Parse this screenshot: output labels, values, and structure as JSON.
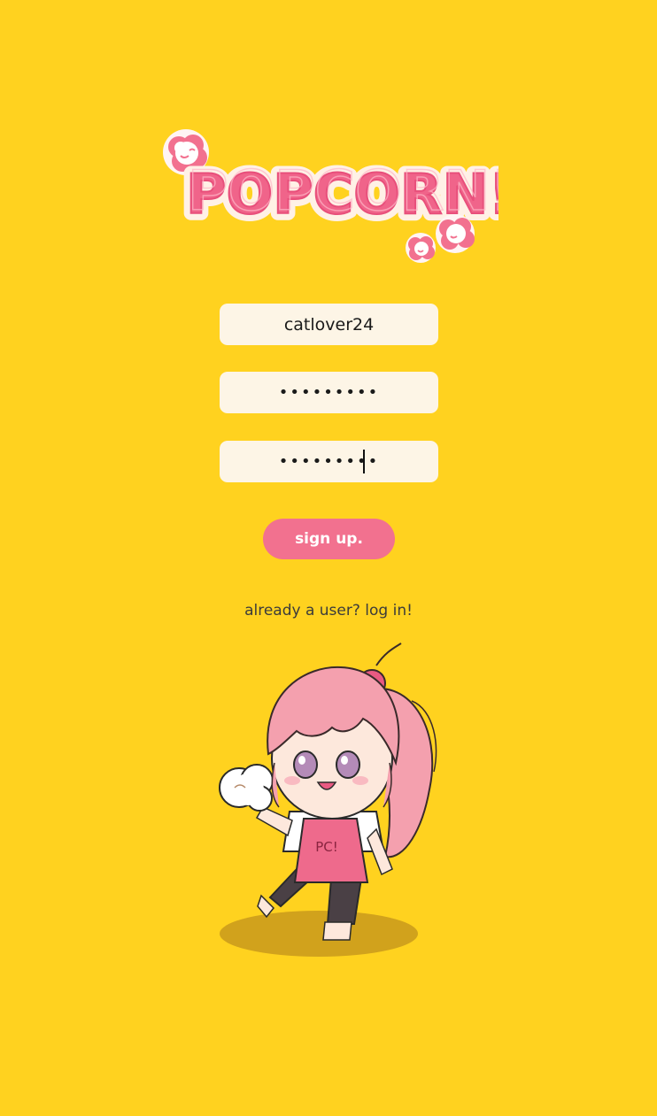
{
  "app": {
    "logo_text": "POPCORN!"
  },
  "form": {
    "username_value": "catlover24",
    "password_value": "•••••••••",
    "confirm_password_value": "•••••••••",
    "signup_label": "sign up.",
    "login_link": "already a user? log in!"
  },
  "mascot": {
    "apron_text": "PC!"
  },
  "colors": {
    "background": "#FFD21F",
    "input_background": "#FDF5E6",
    "button": "#F2718F",
    "logo_pink": "#F0648A",
    "logo_outline": "#FFF1E6",
    "link_text": "#3B3B3B"
  },
  "icons": {
    "logo_decoration": "popcorn-kernel-icon",
    "mascot": "anime-girl-holding-popcorn"
  }
}
